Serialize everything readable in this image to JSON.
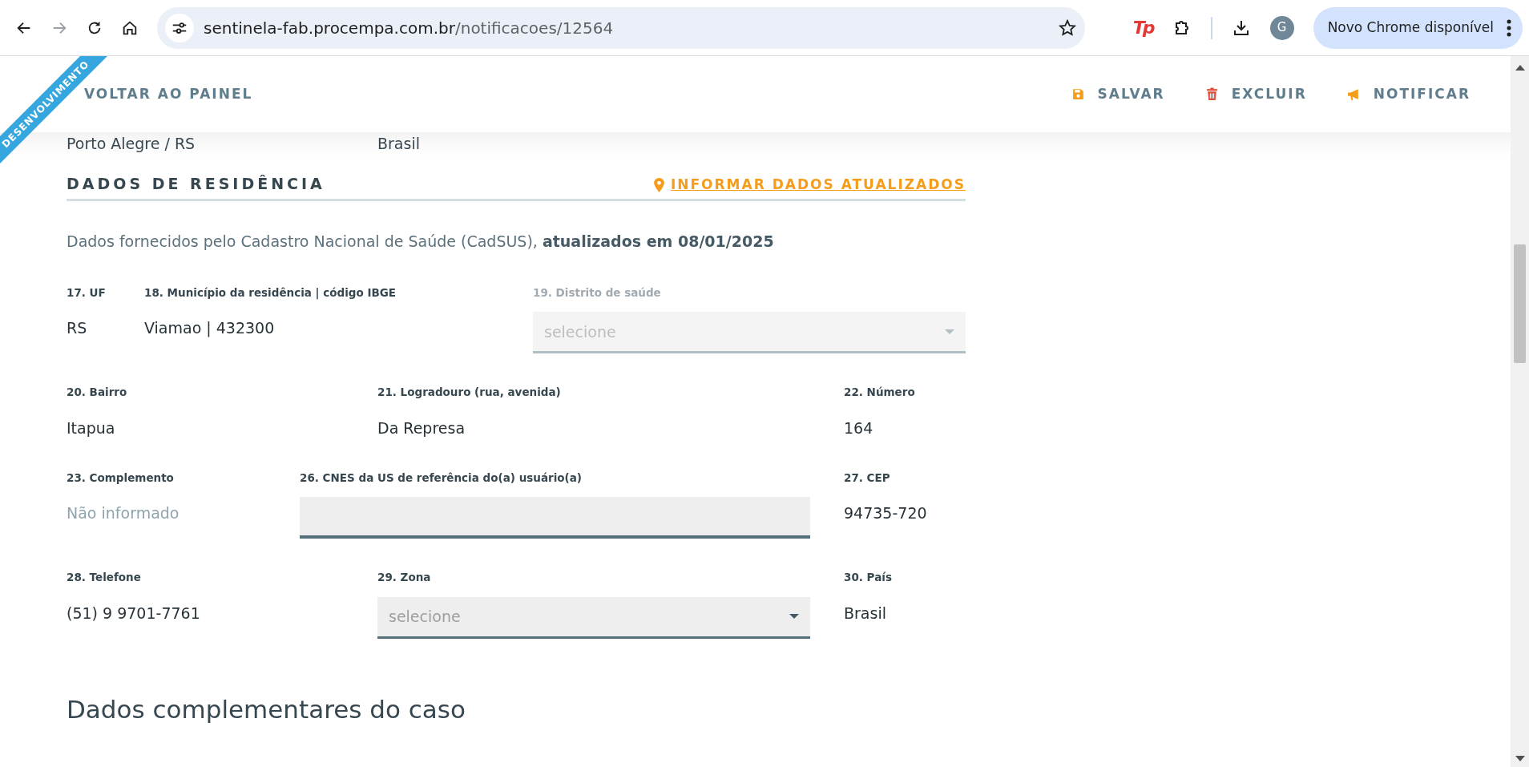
{
  "browser": {
    "url_host": "sentinela-fab.procempa.com.br",
    "url_path": "/notificacoes/12564",
    "extension_logo": "Tp",
    "avatar": "G",
    "update_button": "Novo Chrome disponível"
  },
  "ribbon": "DESENVOLVIMENTO",
  "header": {
    "back": "VOLTAR AO PAINEL",
    "actions": [
      {
        "label": "SALVAR",
        "kind": "save"
      },
      {
        "label": "EXCLUIR",
        "kind": "delete"
      },
      {
        "label": "NOTIFICAR",
        "kind": "notify"
      }
    ]
  },
  "previous_row": [
    "Porto Alegre / RS",
    "Brasil"
  ],
  "section": {
    "title": "DADOS DE RESIDÊNCIA",
    "link": "INFORMAR DADOS ATUALIZADOS",
    "note": "Dados fornecidos pelo Cadastro Nacional de Saúde (CadSUS), **atualizados em 08/01/2025**"
  },
  "fields": [
    {
      "label": "17. UF",
      "kind": "text",
      "value": "RS",
      "disabled": false
    },
    {
      "label": "18. Município da residência | código IBGE",
      "kind": "text",
      "value": "Viamao | 432300",
      "disabled": false
    },
    {
      "label": "19. Distrito de saúde",
      "kind": "select",
      "placeholder": "selecione",
      "disabled": true
    },
    {
      "label": "20. Bairro",
      "kind": "text",
      "value": "Itapua",
      "disabled": false
    },
    {
      "label": "21. Logradouro (rua, avenida)",
      "kind": "text",
      "value": "Da Represa",
      "disabled": false
    },
    {
      "label": "22. Número",
      "kind": "text",
      "value": "164",
      "disabled": false
    },
    {
      "label": "23. Complemento",
      "kind": "missing",
      "value": "Não informado",
      "disabled": false
    },
    {
      "label": "26. CNES da US de referência do(a) usuário(a)",
      "kind": "input",
      "disabled": false
    },
    {
      "label": "27. CEP",
      "kind": "text",
      "value": "94735-720",
      "disabled": false
    },
    {
      "label": "28. Telefone",
      "kind": "text",
      "value": "(51) 9 9701-7761",
      "disabled": false
    },
    {
      "label": "29. Zona",
      "kind": "select",
      "placeholder": "selecione",
      "disabled": false
    },
    {
      "label": "30. País",
      "kind": "text",
      "value": "Brasil",
      "disabled": false
    }
  ],
  "next_section": "Dados complementares do caso"
}
